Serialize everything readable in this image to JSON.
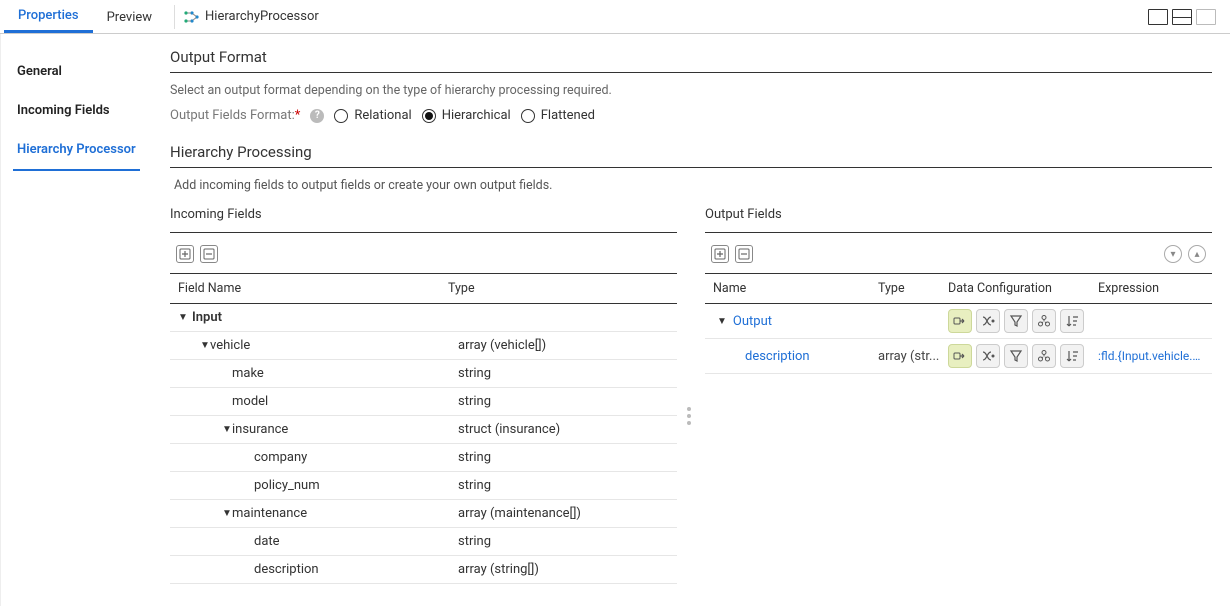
{
  "tabs": {
    "properties": "Properties",
    "preview": "Preview"
  },
  "processor_name": "HierarchyProcessor",
  "sidebar": {
    "general": "General",
    "incoming": "Incoming Fields",
    "hproc": "Hierarchy Processor"
  },
  "output_format": {
    "title": "Output Format",
    "subtitle": "Select an output format depending on the type of hierarchy processing required.",
    "label": "Output Fields Format:",
    "options": {
      "relational": "Relational",
      "hierarchical": "Hierarchical",
      "flattened": "Flattened"
    }
  },
  "hier_proc": {
    "title": "Hierarchy Processing",
    "subtitle": "Add incoming fields to output fields or create your own output fields."
  },
  "incoming": {
    "panel_title": "Incoming Fields",
    "headers": {
      "name": "Field Name",
      "type": "Type"
    },
    "root": "Input",
    "rows": [
      {
        "indent": 1,
        "arrow": true,
        "name": "vehicle",
        "type": "array (vehicle[])"
      },
      {
        "indent": 2,
        "arrow": false,
        "name": "make",
        "type": "string"
      },
      {
        "indent": 2,
        "arrow": false,
        "name": "model",
        "type": "string"
      },
      {
        "indent": 2,
        "arrow": true,
        "name": "insurance",
        "type": "struct (insurance)"
      },
      {
        "indent": 3,
        "arrow": false,
        "name": "company",
        "type": "string"
      },
      {
        "indent": 3,
        "arrow": false,
        "name": "policy_num",
        "type": "string"
      },
      {
        "indent": 2,
        "arrow": true,
        "name": "maintenance",
        "type": "array (maintenance[])"
      },
      {
        "indent": 3,
        "arrow": false,
        "name": "date",
        "type": "string"
      },
      {
        "indent": 3,
        "arrow": false,
        "name": "description",
        "type": "array (string[])"
      }
    ]
  },
  "output": {
    "panel_title": "Output Fields",
    "headers": {
      "name": "Name",
      "type": "Type",
      "dc": "Data Configuration",
      "exp": "Expression"
    },
    "rows": [
      {
        "indent": 0,
        "arrow": true,
        "name": "Output",
        "type": "",
        "exp": ""
      },
      {
        "indent": 1,
        "arrow": false,
        "name": "description",
        "type": "array (str...",
        "exp": ":fld.{Input.vehicle.vel"
      }
    ]
  }
}
